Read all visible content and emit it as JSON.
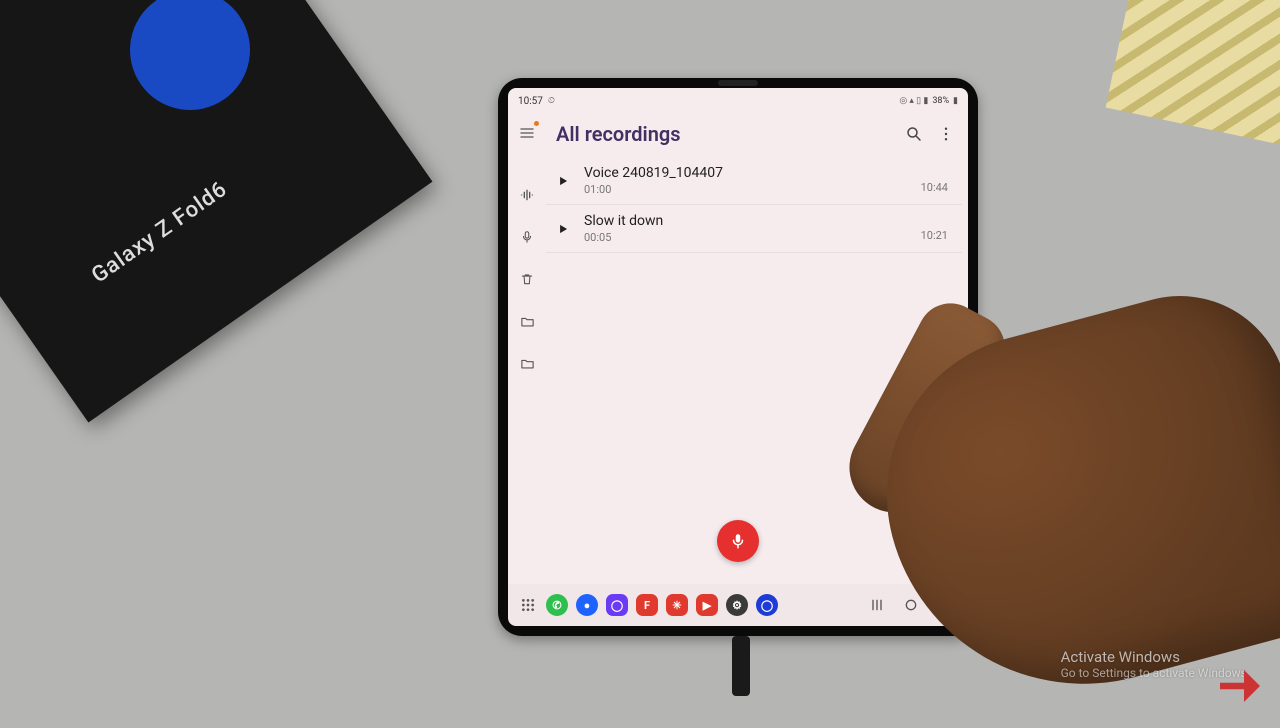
{
  "environment": {
    "device_label": "Galaxy Z Fold6",
    "watermark_title": "Activate Windows",
    "watermark_sub": "Go to Settings to activate Windows."
  },
  "statusbar": {
    "time": "10:57",
    "left_indicator": "⏲",
    "right_icons": "◎ ▴ ▯ ▮",
    "battery_text": "38%"
  },
  "header": {
    "title": "All recordings"
  },
  "sidebar": {
    "items": [
      {
        "name": "menu",
        "icon": "≡"
      },
      {
        "name": "transcribe",
        "icon": "⩚"
      },
      {
        "name": "mic",
        "icon": "mic"
      },
      {
        "name": "trash",
        "icon": "trash"
      },
      {
        "name": "folder-1",
        "icon": "folder"
      },
      {
        "name": "folder-2",
        "icon": "folder"
      }
    ]
  },
  "recordings": [
    {
      "name": "Voice 240819_104407",
      "duration": "01:00",
      "time": "10:44"
    },
    {
      "name": "Slow it down",
      "duration": "00:05",
      "time": "10:21"
    }
  ],
  "dock": {
    "apps": [
      {
        "name": "phone",
        "bg": "#2fbf4c",
        "glyph": "✆",
        "shape": "circle"
      },
      {
        "name": "messages",
        "bg": "#1f63ff",
        "glyph": "●",
        "shape": "circle"
      },
      {
        "name": "viber",
        "bg": "#6b3af5",
        "glyph": "◯",
        "shape": "round"
      },
      {
        "name": "flipboard",
        "bg": "#e0392d",
        "glyph": "F",
        "shape": "round"
      },
      {
        "name": "app-red1",
        "bg": "#e0392d",
        "glyph": "✳",
        "shape": "round"
      },
      {
        "name": "youtube",
        "bg": "#e0392d",
        "glyph": "▶",
        "shape": "round"
      },
      {
        "name": "settings",
        "bg": "#3a3a3a",
        "glyph": "⚙",
        "shape": "circle"
      },
      {
        "name": "app-blue",
        "bg": "#1f3bd6",
        "glyph": "◯",
        "shape": "circle"
      }
    ]
  }
}
